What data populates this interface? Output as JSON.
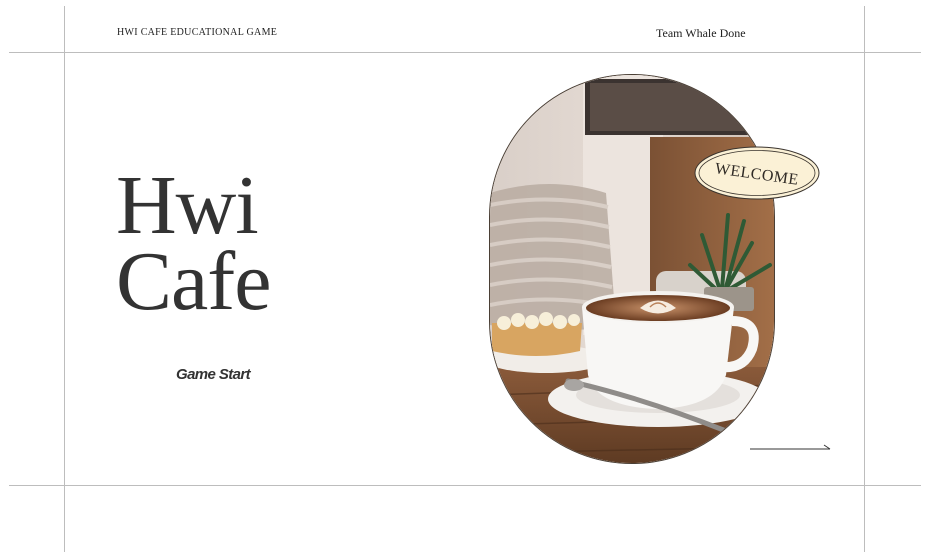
{
  "header": {
    "left_label": "HWI CAFE EDUCATIONAL GAME",
    "right_label": "Team Whale Done"
  },
  "hero": {
    "title_line1": "Hwi",
    "title_line2": "Cafe",
    "start_label": "Game Start"
  },
  "badge": {
    "label": "WELCOME"
  },
  "icons": {
    "next": "arrow-right-icon"
  },
  "colors": {
    "badge_fill": "#fbf1d6",
    "outline": "#3a342e",
    "text": "#333333"
  }
}
